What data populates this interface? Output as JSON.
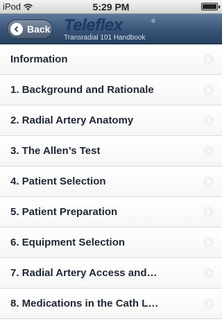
{
  "status": {
    "carrier": "iPod",
    "time": "5:29 PM"
  },
  "nav": {
    "back_label": "Back",
    "brand_name": "Teleflex",
    "brand_subtitle": "Transradial 101 Handbook"
  },
  "menu": {
    "items": [
      {
        "label": "Information"
      },
      {
        "label": "1. Background and Rationale"
      },
      {
        "label": "2. Radial Artery Anatomy"
      },
      {
        "label": "3. The Allen’s Test"
      },
      {
        "label": "4. Patient Selection"
      },
      {
        "label": "5. Patient Preparation"
      },
      {
        "label": "6. Equipment Selection"
      },
      {
        "label": "7. Radial Artery Access and…"
      },
      {
        "label": "8. Medications in the Cath L…"
      }
    ]
  },
  "colors": {
    "nav_top": "#5f7a9d",
    "nav_bottom": "#26405f",
    "list_text": "#1e2733"
  }
}
